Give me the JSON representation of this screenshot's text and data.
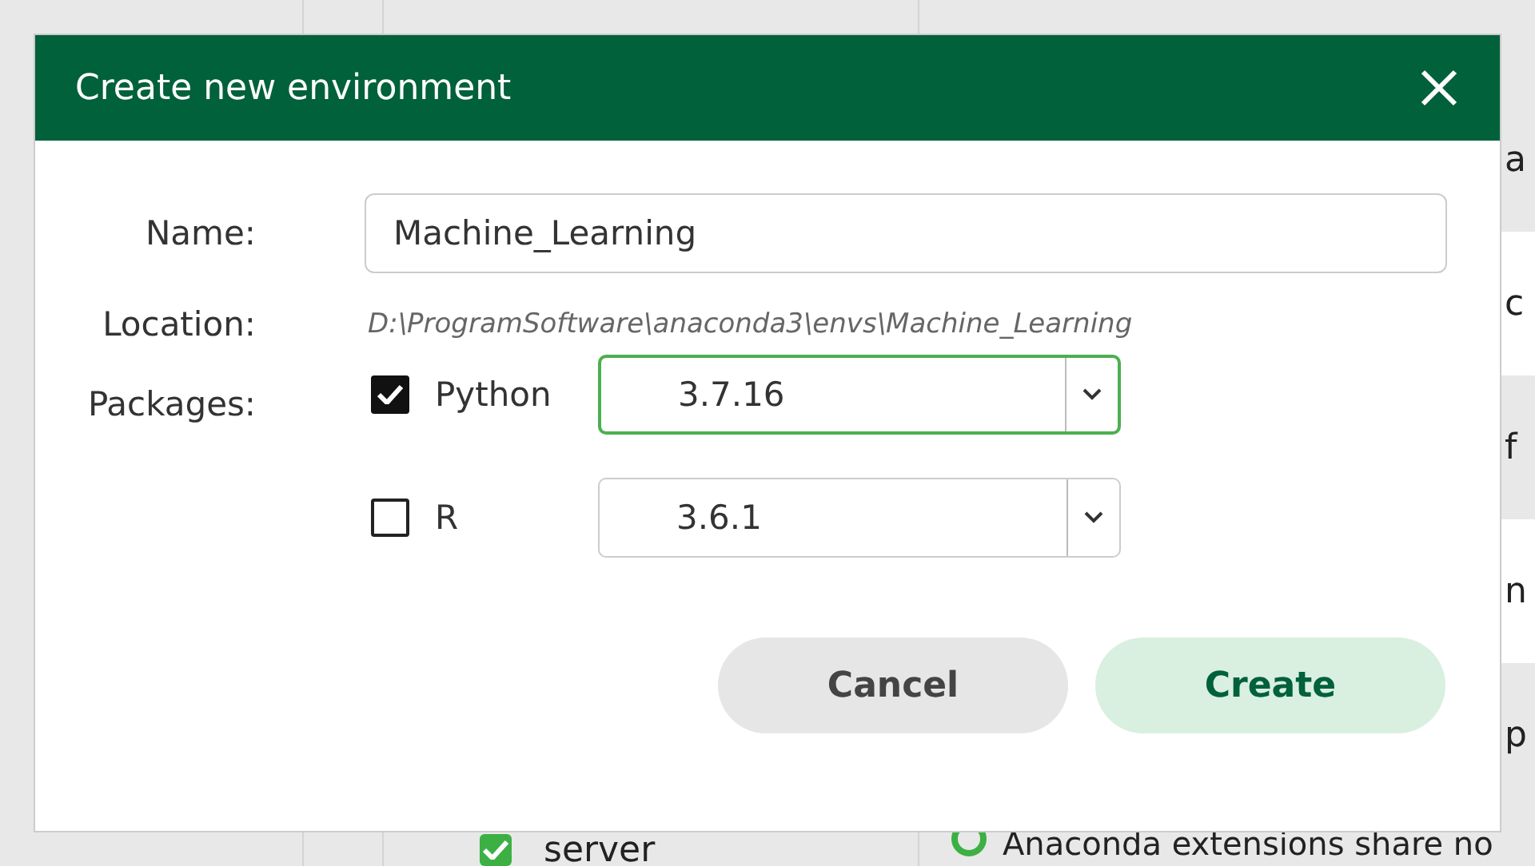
{
  "background": {
    "fragments": [
      "a",
      "c",
      "f",
      "n",
      "p"
    ],
    "bottom_row": {
      "checked": true,
      "text": "server",
      "status_text": "Anaconda extensions share no"
    }
  },
  "dialog": {
    "title": "Create new environment",
    "name": {
      "label": "Name:",
      "value": "Machine_Learning"
    },
    "location": {
      "label": "Location:",
      "value": "D:\\ProgramSoftware\\anaconda3\\envs\\Machine_Learning"
    },
    "packages": {
      "label": "Packages:",
      "items": [
        {
          "name": "Python",
          "checked": true,
          "version": "3.7.16",
          "focused": true
        },
        {
          "name": "R",
          "checked": false,
          "version": "3.6.1",
          "focused": false
        }
      ]
    },
    "buttons": [
      {
        "label": "Cancel",
        "kind": "secondary"
      },
      {
        "label": "Create",
        "kind": "primary"
      }
    ]
  }
}
